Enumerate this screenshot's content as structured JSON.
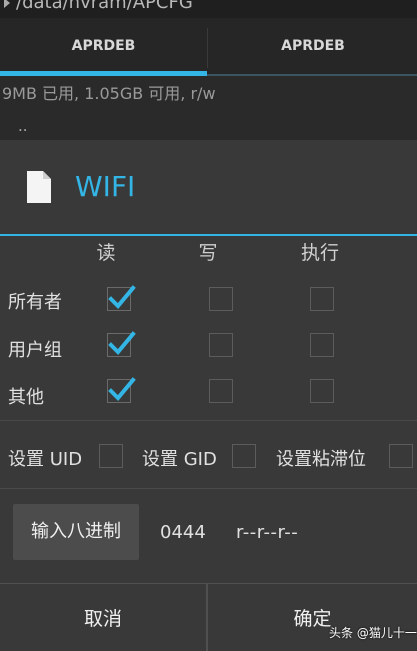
{
  "background": {
    "path": "/data/nvram/APCFG",
    "tabs": [
      "APRDEB",
      "APRDEB"
    ],
    "usage": "9MB 已用, 1.05GB 可用, r/w",
    "parent": ".."
  },
  "dialog": {
    "title": "WIFI",
    "columns": [
      "读",
      "写",
      "执行"
    ],
    "rows": [
      {
        "label": "所有者",
        "read": true,
        "write": false,
        "execute": false
      },
      {
        "label": "用户组",
        "read": true,
        "write": false,
        "execute": false
      },
      {
        "label": "其他",
        "read": true,
        "write": false,
        "execute": false
      }
    ],
    "options": [
      {
        "label": "设置 UID",
        "checked": false
      },
      {
        "label": "设置 GID",
        "checked": false
      },
      {
        "label": "设置粘滞位",
        "checked": false
      }
    ],
    "octal_button": "输入八进制",
    "octal_value": "0444",
    "permission_string": "r--r--r--",
    "cancel": "取消",
    "ok": "确定"
  },
  "watermark": "头条 @猫儿十一",
  "colors": {
    "accent": "#33b5e5",
    "dialog_bg": "#393939"
  }
}
